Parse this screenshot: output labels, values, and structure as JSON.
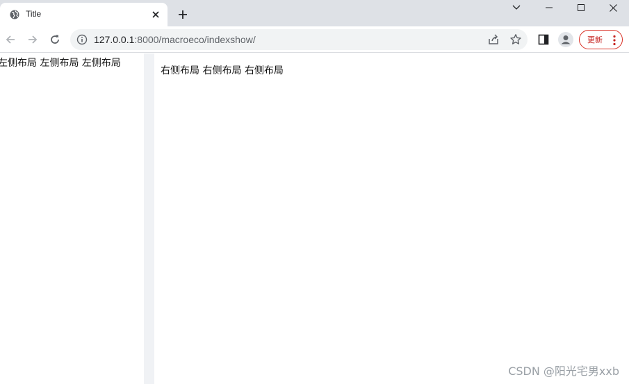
{
  "browser": {
    "tab": {
      "title": "Title"
    },
    "address": {
      "host": "127.0.0.1",
      "rest": ":8000/macroeco/indexshow/"
    },
    "update_label": "更新"
  },
  "page": {
    "left_text": "左侧布局 左侧布局 左侧布局",
    "right_text": "右侧布局 右侧布局 右侧布局"
  },
  "watermark": "CSDN @阳光宅男xxb",
  "colors": {
    "tabstrip": "#dee1e6",
    "omnibox": "#f1f3f4",
    "update_border": "#d93025",
    "splitter": "#f0f2f5"
  }
}
